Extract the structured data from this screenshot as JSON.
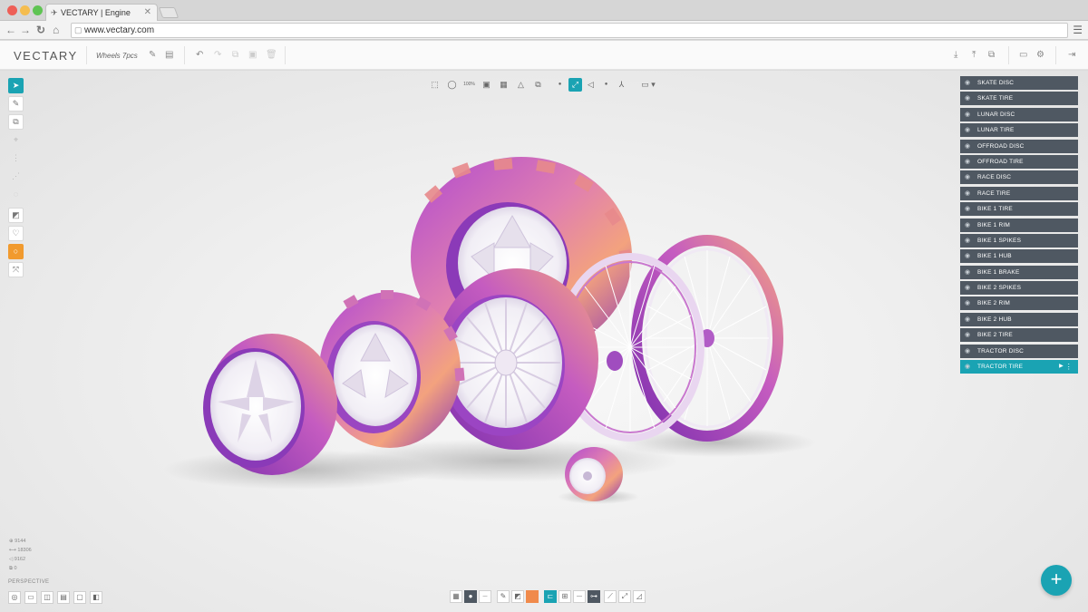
{
  "browser": {
    "tab_title": "VECTARY | Engine",
    "url": "www.vectary.com",
    "colors": {
      "close": "#ee5f57",
      "minimize": "#f5bd4f",
      "maximize": "#5fc453"
    }
  },
  "app": {
    "logo": "VECTARY",
    "scene_name": "Wheels 7pcs"
  },
  "layers": [
    {
      "label": "SKATE DISC"
    },
    {
      "label": "SKATE TIRE"
    },
    {
      "label": "LUNAR DISC"
    },
    {
      "label": "LUNAR TIRE"
    },
    {
      "label": "OFFROAD DISC"
    },
    {
      "label": "OFFROAD TIRE"
    },
    {
      "label": "RACE DISC"
    },
    {
      "label": "RACE TIRE"
    },
    {
      "label": "BIKE 1 TIRE"
    },
    {
      "label": "BIKE 1 RIM"
    },
    {
      "label": "BIKE 1 SPIKES"
    },
    {
      "label": "BIKE 1 HUB"
    },
    {
      "label": "BIKE 1 BRAKE"
    },
    {
      "label": "BIKE 2 SPIKES"
    },
    {
      "label": "BIKE 2 RIM"
    },
    {
      "label": "BIKE 2 HUB"
    },
    {
      "label": "BIKE 2 TIRE"
    },
    {
      "label": "TRACTOR DISC"
    },
    {
      "label": "TRACTOR TIRE",
      "selected": true
    }
  ],
  "stats": {
    "vertices": "9144",
    "edges": "18306",
    "faces": "9162",
    "objects": "0"
  },
  "view_mode": "PERSPECTIVE",
  "toolbar": {
    "resolution_label": "100%"
  },
  "colors": {
    "accent": "#1aa3b3",
    "layer_bg": "#4f5862",
    "orange": "#f19a2e",
    "tire_purple": "#9a3fc0",
    "tire_peach": "#f3a27e"
  }
}
